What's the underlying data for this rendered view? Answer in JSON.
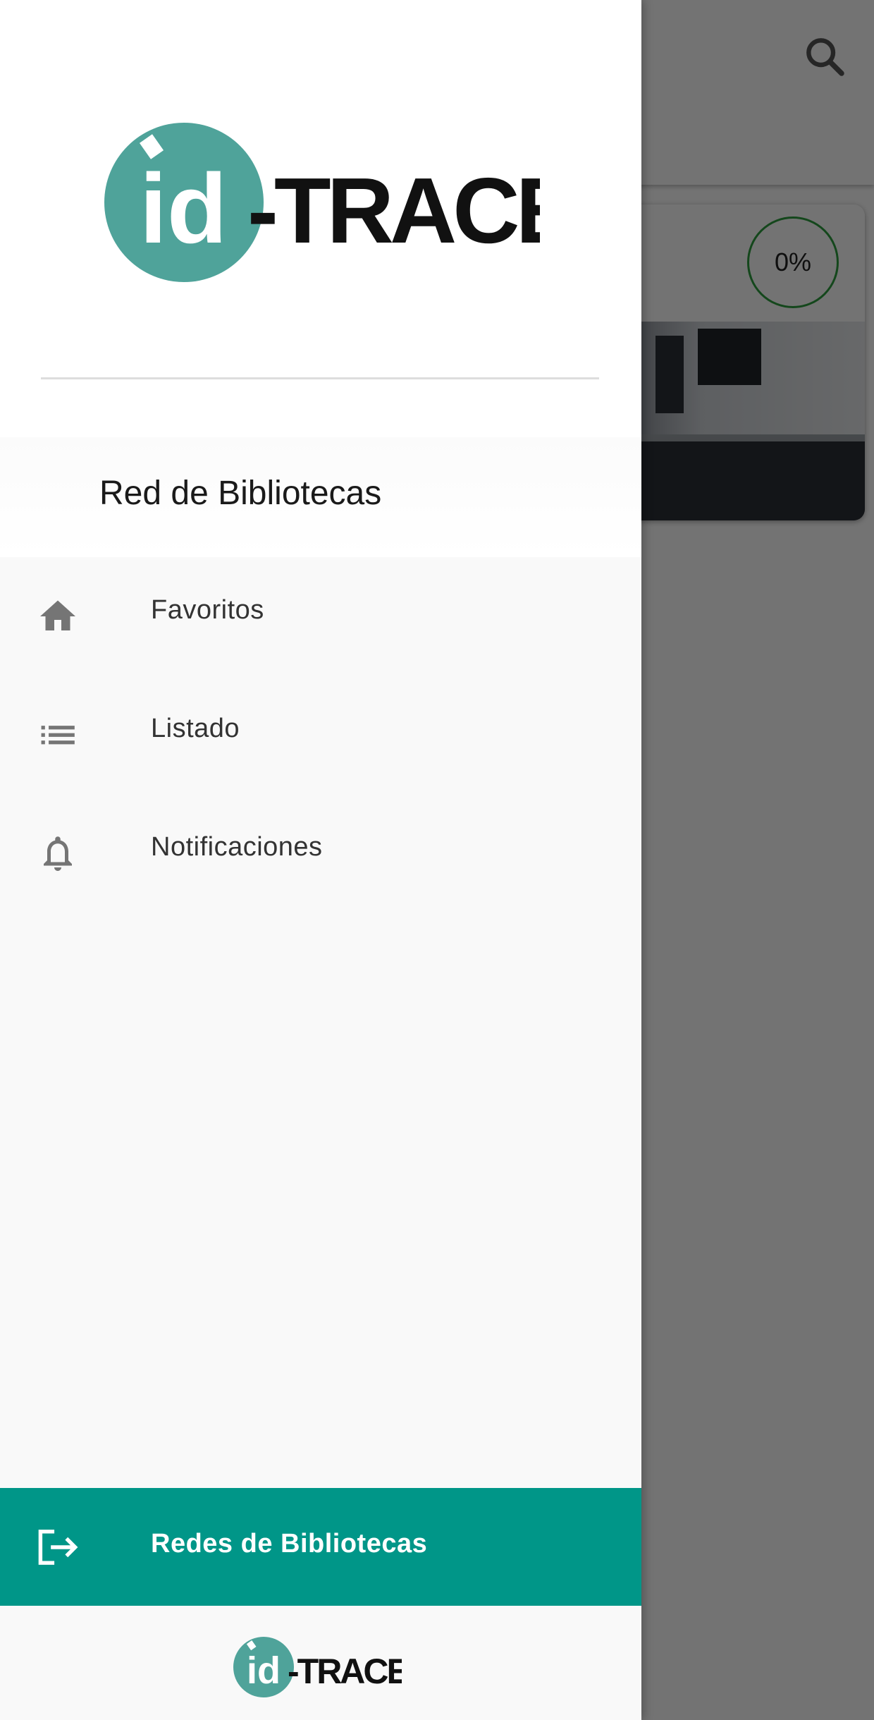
{
  "background": {
    "card": {
      "progress_text": "0%"
    }
  },
  "drawer": {
    "logo": {
      "brand_mark": "id",
      "brand_text": "-TRACE"
    },
    "network_title": "Red de Bibliotecas",
    "menu": [
      {
        "label": "Favoritos",
        "icon": "home-icon"
      },
      {
        "label": "Listado",
        "icon": "list-icon"
      },
      {
        "label": "Notificaciones",
        "icon": "bell-icon"
      }
    ],
    "footer_button": {
      "label": "Redes de Bibliotecas",
      "icon": "logout-icon"
    },
    "footer_logo": {
      "brand_mark": "id",
      "brand_text": "-TRACE"
    }
  },
  "colors": {
    "accent": "#009688",
    "logo_teal": "#4fa39a",
    "progress_ring": "#2e9e3e"
  }
}
